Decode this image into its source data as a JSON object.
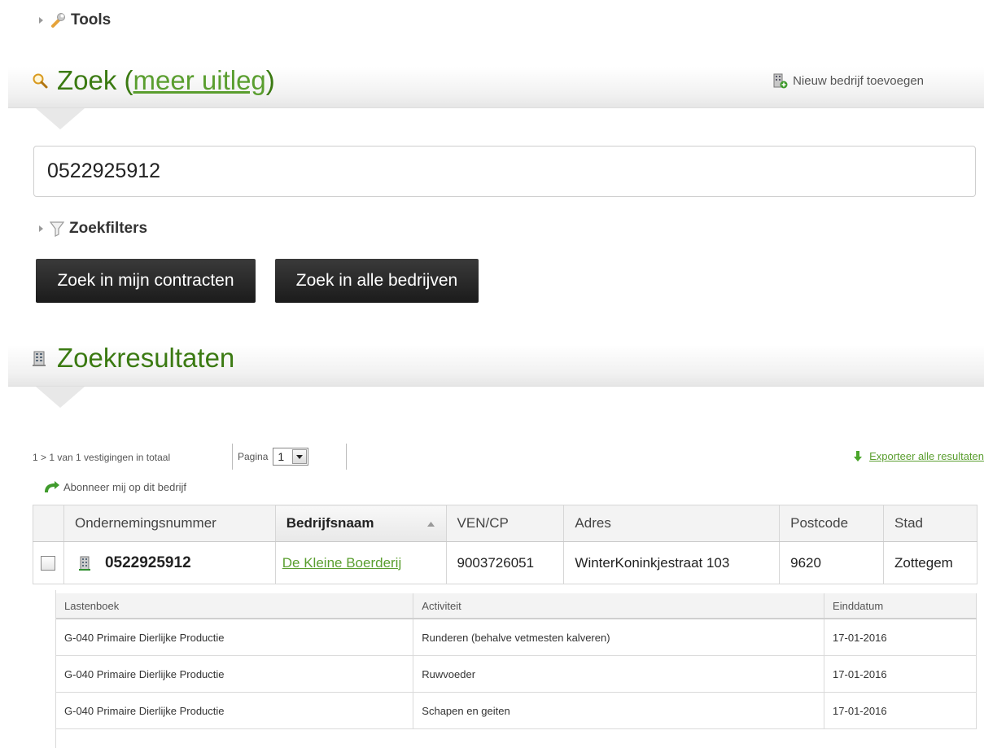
{
  "tools": {
    "label": "Tools"
  },
  "search_section": {
    "title_prefix": "Zoek (",
    "title_link": "meer uitleg",
    "title_suffix": ")",
    "new_company_label": "Nieuw bedrijf toevoegen",
    "search_value": "0522925912",
    "filters_label": "Zoekfilters",
    "btn_my_contracts": "Zoek in mijn contracten",
    "btn_all_companies": "Zoek in alle bedrijven"
  },
  "results_section": {
    "title": "Zoekresultaten",
    "summary": "1 > 1 van 1 vestigingen in totaal",
    "page_label": "Pagina",
    "page_value": "1",
    "export_label": "Exporteer alle resultaten",
    "subscribe_label": "Abonneer mij op dit bedrijf"
  },
  "table": {
    "headers": [
      "Ondernemingsnummer",
      "Bedrijfsnaam",
      "VEN/CP",
      "Adres",
      "Postcode",
      "Stad"
    ],
    "rows": [
      {
        "ondernemingsnummer": "0522925912",
        "bedrijfsnaam": "De Kleine Boerderij",
        "ven_cp": "9003726051",
        "adres": "WinterKoninkjestraat 103",
        "postcode": "9620",
        "stad": "Zottegem"
      }
    ]
  },
  "subtable": {
    "headers": [
      "Lastenboek",
      "Activiteit",
      "Einddatum"
    ],
    "rows": [
      [
        "G-040 Primaire Dierlijke Productie",
        "Runderen (behalve vetmesten kalveren)",
        "17-01-2016"
      ],
      [
        "G-040 Primaire Dierlijke Productie",
        "Ruwvoeder",
        "17-01-2016"
      ],
      [
        "G-040 Primaire Dierlijke Productie",
        "Schapen en geiten",
        "17-01-2016"
      ]
    ]
  },
  "colors": {
    "accent_green": "#3b7a12",
    "link_green": "#5a9e2f",
    "button_dark": "#222222"
  },
  "icons": [
    "wrench-icon",
    "magnifier-icon",
    "building-add-icon",
    "filter-icon",
    "building-icon",
    "download-arrow-icon",
    "subscribe-arrow-icon"
  ]
}
